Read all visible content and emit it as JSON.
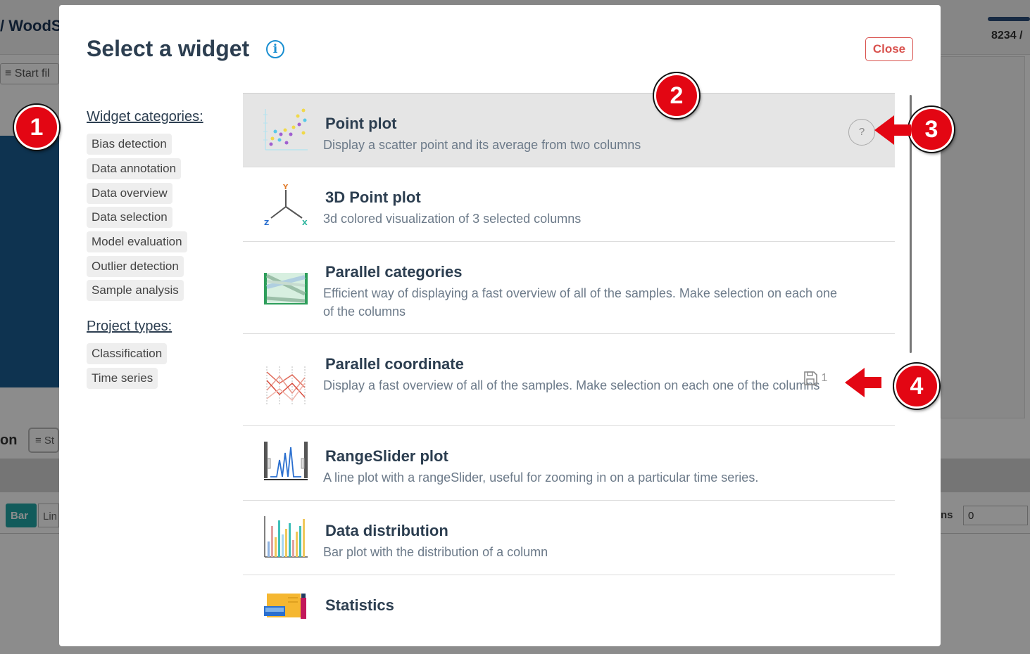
{
  "background": {
    "breadcrumb": "/ WoodS",
    "count": "8234 / ",
    "filter_label": "Start fil",
    "section_fragment": "on",
    "filter2_label": "St",
    "bar_label": "Bar",
    "line_label": "Lin",
    "ns_label": "ns",
    "number_value": "0"
  },
  "modal": {
    "title": "Select a widget",
    "info_glyph": "i",
    "close_label": "Close"
  },
  "sidebar": {
    "categories_heading": "Widget categories:",
    "categories": [
      "Bias detection",
      "Data annotation",
      "Data overview",
      "Data selection",
      "Model evaluation",
      "Outlier detection",
      "Sample analysis"
    ],
    "project_types_heading": "Project types:",
    "project_types": [
      "Classification",
      "Time series"
    ]
  },
  "widgets": [
    {
      "title": "Point plot",
      "description": "Display a scatter point and its average from two columns",
      "icon": "scatter-plot-icon",
      "help": "?"
    },
    {
      "title": "3D Point plot",
      "description": "3d colored visualization of 3 selected columns",
      "icon": "3d-axes-icon"
    },
    {
      "title": "Parallel categories",
      "description": "Efficient way of displaying a fast overview of all of the samples. Make selection on each one of the columns",
      "icon": "parallel-categories-icon"
    },
    {
      "title": "Parallel coordinate",
      "description": "Display a fast overview of all of the samples. Make selection on each one of the columns",
      "icon": "parallel-coordinates-icon",
      "saved_count": "1"
    },
    {
      "title": "RangeSlider plot",
      "description": "A line plot with a rangeSlider, useful for zooming in on a particular time series.",
      "icon": "range-slider-icon"
    },
    {
      "title": "Data distribution",
      "description": "Bar plot with the distribution of a column",
      "icon": "bar-chart-icon"
    },
    {
      "title": "Statistics",
      "description": "",
      "icon": "statistics-icon"
    }
  ],
  "axes_labels": {
    "y": "Y",
    "z": "Z",
    "x": "X"
  },
  "annotations": [
    "1",
    "2",
    "3",
    "4"
  ],
  "colors": {
    "accent_red": "#e30613",
    "close_red": "#d9534f",
    "info_blue": "#1a8fd1",
    "title_dark": "#2c3e50"
  }
}
